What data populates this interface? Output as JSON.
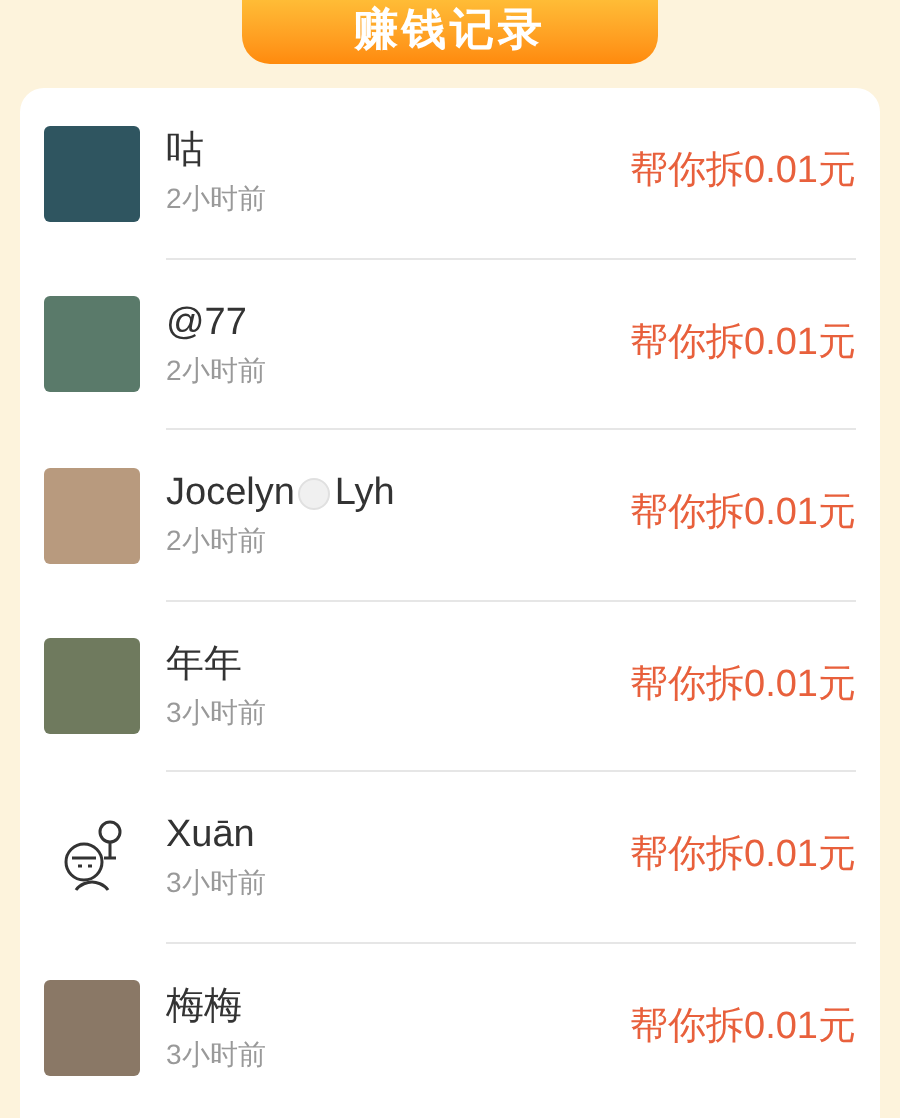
{
  "header": {
    "title": "赚钱记录"
  },
  "records": [
    {
      "kind": "photo",
      "color": "#2f5560",
      "name": "咕",
      "time": "2小时前",
      "amount": "帮你拆0.01元"
    },
    {
      "kind": "photo",
      "color": "#5a7a6a",
      "name": "@77",
      "time": "2小时前",
      "amount": "帮你拆0.01元"
    },
    {
      "kind": "photo",
      "color": "#b89a7e",
      "name": "Jocelyn",
      "name_after_emoji": "Lyh",
      "time": "2小时前",
      "amount": "帮你拆0.01元"
    },
    {
      "kind": "photo",
      "color": "#6f7a5e",
      "name": "年年",
      "time": "3小时前",
      "amount": "帮你拆0.01元"
    },
    {
      "kind": "drawing",
      "name": "Xuān",
      "time": "3小时前",
      "amount": "帮你拆0.01元"
    },
    {
      "kind": "photo",
      "color": "#8a7866",
      "name": "梅梅",
      "time": "3小时前",
      "amount": "帮你拆0.01元"
    }
  ]
}
